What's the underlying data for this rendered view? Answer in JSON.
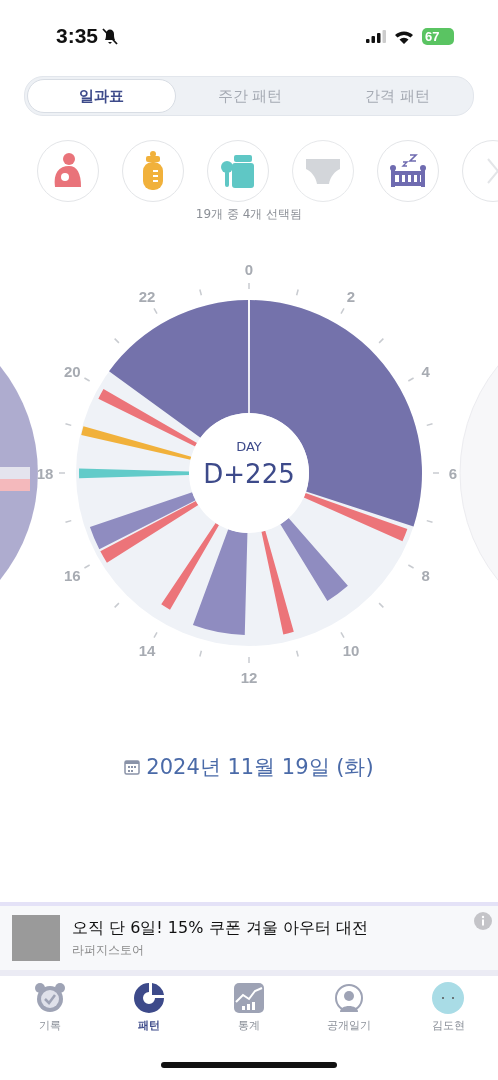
{
  "status_bar": {
    "time": "3:35",
    "battery": "67"
  },
  "tabs": [
    {
      "label": "일과표",
      "selected": true
    },
    {
      "label": "주간 패턴",
      "selected": false
    },
    {
      "label": "간격 패턴",
      "selected": false
    }
  ],
  "filters": [
    {
      "kind": "breastfeed",
      "selected": true
    },
    {
      "kind": "bottle",
      "selected": true
    },
    {
      "kind": "food",
      "selected": true
    },
    {
      "kind": "diaper",
      "selected": false
    },
    {
      "kind": "sleep",
      "selected": true
    },
    {
      "kind": "more"
    }
  ],
  "filter_caption": "19개 중 4개 선택됨",
  "clock": {
    "hour_labels": [
      "0",
      "2",
      "4",
      "6",
      "8",
      "10",
      "12",
      "14",
      "16",
      "18",
      "20",
      "22"
    ],
    "center_caption": "DAY",
    "center_value": "D+225"
  },
  "date": "2024년 11월 19일 (화)",
  "ad": {
    "title": "오직 단 6일! 15% 쿠폰 겨울 아우터 대전",
    "advertiser": "라퍼지스토어"
  },
  "nav": [
    {
      "kind": "record",
      "label": "기록",
      "selected": false
    },
    {
      "kind": "pattern",
      "label": "패턴",
      "selected": true
    },
    {
      "kind": "stats",
      "label": "통계",
      "selected": false
    },
    {
      "kind": "diary",
      "label": "공개일기",
      "selected": false
    },
    {
      "kind": "profile",
      "label": "김도현",
      "selected": false
    }
  ]
}
